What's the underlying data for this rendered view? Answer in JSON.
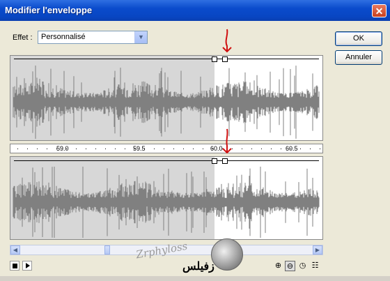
{
  "window": {
    "title": "Modifier l'enveloppe",
    "close_glyph": "✕"
  },
  "effect": {
    "label": "Effet :",
    "selected": "Personnalisé"
  },
  "buttons": {
    "ok": "OK",
    "cancel": "Annuler"
  },
  "ruler": {
    "labels": [
      "59.0",
      "59.5",
      "60.0",
      "60.5"
    ]
  },
  "watermark": {
    "script": "Zrphyloss",
    "arabic": "زفيلس"
  },
  "annotations": {
    "arrow_color": "#d01010"
  },
  "colors": {
    "waveform": "#808080",
    "selection_bg": "#d7d7d7",
    "titlebar": "#0a4bcc"
  },
  "icons": [
    "stop-icon",
    "play-icon",
    "zoom-in-icon",
    "zoom-out-icon",
    "zoom-full-icon",
    "zoom-selection-icon"
  ]
}
